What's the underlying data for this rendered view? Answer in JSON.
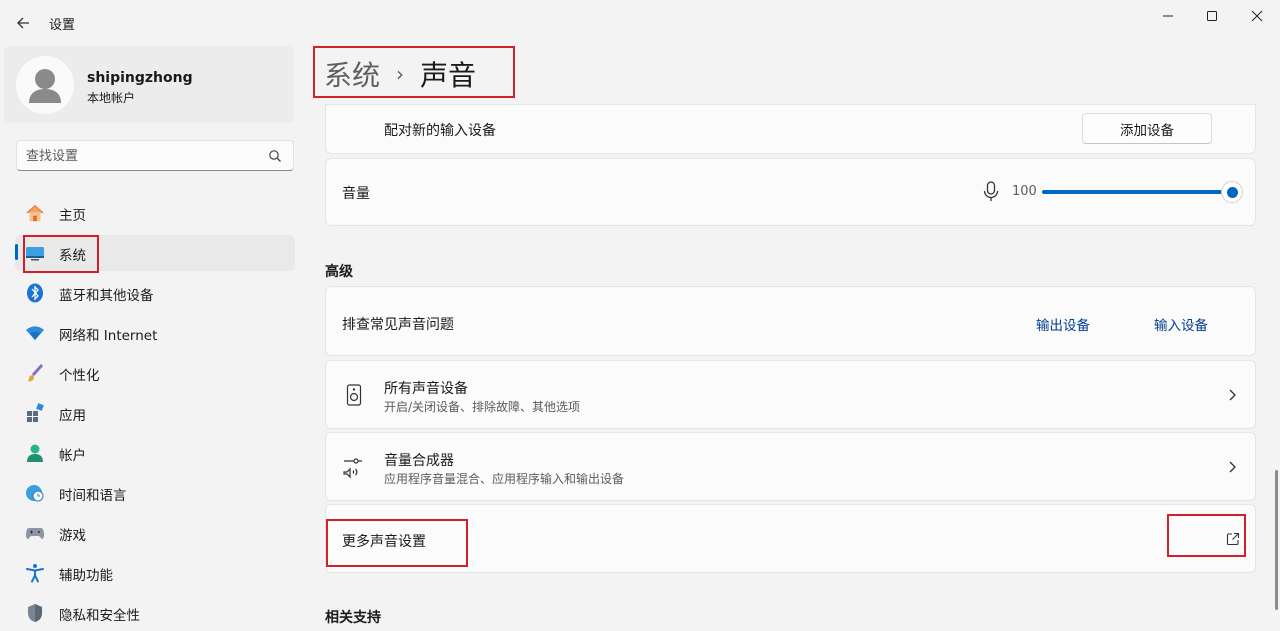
{
  "app": {
    "title": "设置"
  },
  "window": {
    "minimize_icon": "minimize-icon",
    "maximize_icon": "maximize-icon",
    "close_icon": "close-icon"
  },
  "profile": {
    "name": "shipingzhong",
    "account_type": "本地帐户"
  },
  "search": {
    "placeholder": "查找设置"
  },
  "nav": {
    "items": [
      {
        "label": "主页",
        "icon": "home-icon"
      },
      {
        "label": "系统",
        "icon": "system-icon",
        "active": true
      },
      {
        "label": "蓝牙和其他设备",
        "icon": "bluetooth-icon"
      },
      {
        "label": "网络和 Internet",
        "icon": "wifi-icon"
      },
      {
        "label": "个性化",
        "icon": "brush-icon"
      },
      {
        "label": "应用",
        "icon": "apps-icon"
      },
      {
        "label": "帐户",
        "icon": "account-icon"
      },
      {
        "label": "时间和语言",
        "icon": "clock-globe-icon"
      },
      {
        "label": "游戏",
        "icon": "gamepad-icon"
      },
      {
        "label": "辅助功能",
        "icon": "accessibility-icon"
      },
      {
        "label": "隐私和安全性",
        "icon": "shield-icon"
      }
    ]
  },
  "breadcrumb": {
    "parent": "系统",
    "separator": "›",
    "current": "声音"
  },
  "input_pair": {
    "label": "配对新的输入设备",
    "button": "添加设备"
  },
  "volume": {
    "label": "音量",
    "value": "100",
    "level": 1.0,
    "icon": "microphone-icon"
  },
  "advanced": {
    "title": "高级",
    "troubleshoot": {
      "label": "排查常见声音问题",
      "link_output": "输出设备",
      "link_input": "输入设备"
    },
    "all_devices": {
      "title": "所有声音设备",
      "subtitle": "开启/关闭设备、排除故障、其他选项",
      "icon": "speaker-icon"
    },
    "mixer": {
      "title": "音量合成器",
      "subtitle": "应用程序音量混合、应用程序输入和输出设备",
      "icon": "mixer-icon"
    },
    "more": {
      "label": "更多声音设置",
      "icon": "open-external-icon"
    }
  },
  "related": {
    "title": "相关支持"
  },
  "colors": {
    "accent": "#0067c0",
    "link": "#003e92",
    "highlight": "#d0202e"
  }
}
